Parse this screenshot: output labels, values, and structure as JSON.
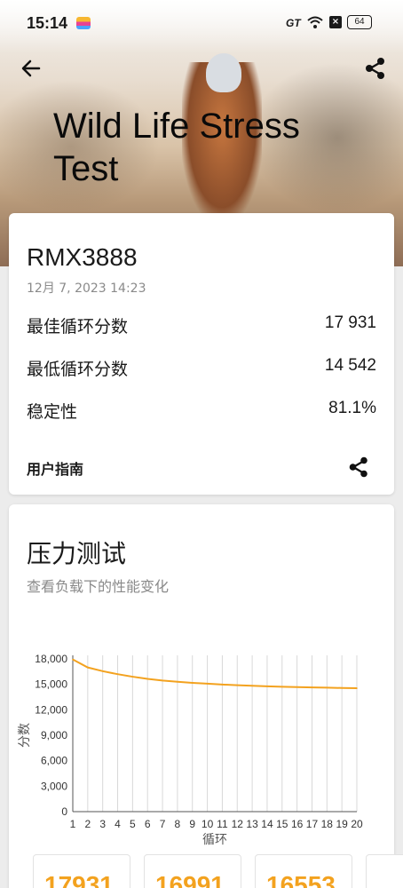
{
  "status_bar": {
    "time": "15:14",
    "gt_label": "GT",
    "battery": "64"
  },
  "header": {
    "title": "Wild Life Stress Test",
    "back_icon": "arrow-left-icon",
    "share_icon": "share-icon"
  },
  "result_card": {
    "device": "RMX3888",
    "date": "12月 7, 2023 14:23",
    "best_label": "最佳循环分数",
    "best_value": "17 931",
    "lowest_label": "最低循环分数",
    "lowest_value": "14 542",
    "stability_label": "稳定性",
    "stability_value": "81.1%",
    "guide_label": "用户指南"
  },
  "stress_section": {
    "title": "压力测试",
    "subtitle": "查看负载下的性能变化"
  },
  "chart_data": {
    "type": "line",
    "xlabel": "循环",
    "ylabel": "分数",
    "x": [
      1,
      2,
      3,
      4,
      5,
      6,
      7,
      8,
      9,
      10,
      11,
      12,
      13,
      14,
      15,
      16,
      17,
      18,
      19,
      20
    ],
    "series": [
      {
        "values": [
          17931,
          16991,
          16553,
          16200,
          15900,
          15650,
          15450,
          15300,
          15180,
          15080,
          14980,
          14900,
          14830,
          14770,
          14720,
          14680,
          14640,
          14610,
          14570,
          14542
        ]
      }
    ],
    "yticks": [
      "0",
      "3,000",
      "6,000",
      "9,000",
      "12,000",
      "15,000",
      "18,000"
    ],
    "ylim": [
      0,
      18000
    ],
    "xlim": [
      1,
      20
    ],
    "grid": "vertical",
    "color": "#f3a21f"
  },
  "cycle_scores": [
    "17931",
    "16991",
    "16553"
  ]
}
